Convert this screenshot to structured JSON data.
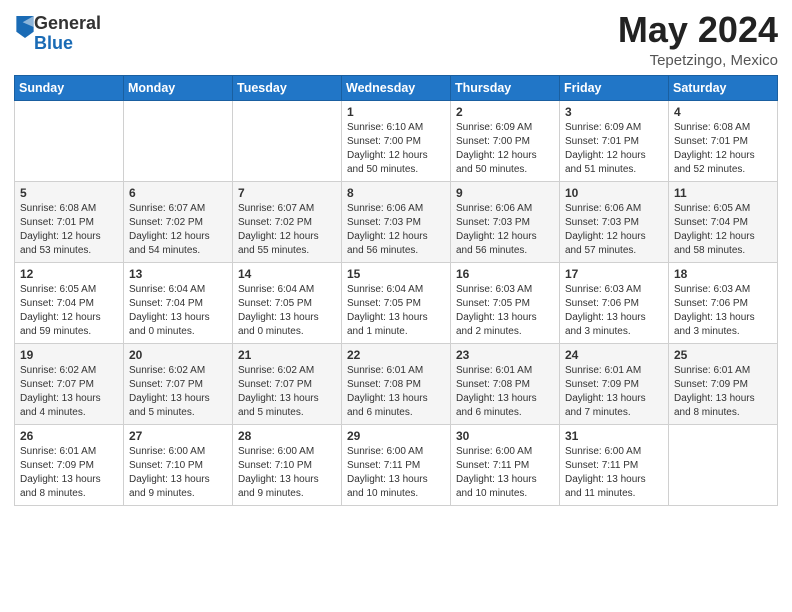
{
  "logo": {
    "general": "General",
    "blue": "Blue"
  },
  "title": "May 2024",
  "subtitle": "Tepetzingo, Mexico",
  "days_of_week": [
    "Sunday",
    "Monday",
    "Tuesday",
    "Wednesday",
    "Thursday",
    "Friday",
    "Saturday"
  ],
  "weeks": [
    [
      {
        "day": "",
        "info": ""
      },
      {
        "day": "",
        "info": ""
      },
      {
        "day": "",
        "info": ""
      },
      {
        "day": "1",
        "info": "Sunrise: 6:10 AM\nSunset: 7:00 PM\nDaylight: 12 hours\nand 50 minutes."
      },
      {
        "day": "2",
        "info": "Sunrise: 6:09 AM\nSunset: 7:00 PM\nDaylight: 12 hours\nand 50 minutes."
      },
      {
        "day": "3",
        "info": "Sunrise: 6:09 AM\nSunset: 7:01 PM\nDaylight: 12 hours\nand 51 minutes."
      },
      {
        "day": "4",
        "info": "Sunrise: 6:08 AM\nSunset: 7:01 PM\nDaylight: 12 hours\nand 52 minutes."
      }
    ],
    [
      {
        "day": "5",
        "info": "Sunrise: 6:08 AM\nSunset: 7:01 PM\nDaylight: 12 hours\nand 53 minutes."
      },
      {
        "day": "6",
        "info": "Sunrise: 6:07 AM\nSunset: 7:02 PM\nDaylight: 12 hours\nand 54 minutes."
      },
      {
        "day": "7",
        "info": "Sunrise: 6:07 AM\nSunset: 7:02 PM\nDaylight: 12 hours\nand 55 minutes."
      },
      {
        "day": "8",
        "info": "Sunrise: 6:06 AM\nSunset: 7:03 PM\nDaylight: 12 hours\nand 56 minutes."
      },
      {
        "day": "9",
        "info": "Sunrise: 6:06 AM\nSunset: 7:03 PM\nDaylight: 12 hours\nand 56 minutes."
      },
      {
        "day": "10",
        "info": "Sunrise: 6:06 AM\nSunset: 7:03 PM\nDaylight: 12 hours\nand 57 minutes."
      },
      {
        "day": "11",
        "info": "Sunrise: 6:05 AM\nSunset: 7:04 PM\nDaylight: 12 hours\nand 58 minutes."
      }
    ],
    [
      {
        "day": "12",
        "info": "Sunrise: 6:05 AM\nSunset: 7:04 PM\nDaylight: 12 hours\nand 59 minutes."
      },
      {
        "day": "13",
        "info": "Sunrise: 6:04 AM\nSunset: 7:04 PM\nDaylight: 13 hours\nand 0 minutes."
      },
      {
        "day": "14",
        "info": "Sunrise: 6:04 AM\nSunset: 7:05 PM\nDaylight: 13 hours\nand 0 minutes."
      },
      {
        "day": "15",
        "info": "Sunrise: 6:04 AM\nSunset: 7:05 PM\nDaylight: 13 hours\nand 1 minute."
      },
      {
        "day": "16",
        "info": "Sunrise: 6:03 AM\nSunset: 7:05 PM\nDaylight: 13 hours\nand 2 minutes."
      },
      {
        "day": "17",
        "info": "Sunrise: 6:03 AM\nSunset: 7:06 PM\nDaylight: 13 hours\nand 3 minutes."
      },
      {
        "day": "18",
        "info": "Sunrise: 6:03 AM\nSunset: 7:06 PM\nDaylight: 13 hours\nand 3 minutes."
      }
    ],
    [
      {
        "day": "19",
        "info": "Sunrise: 6:02 AM\nSunset: 7:07 PM\nDaylight: 13 hours\nand 4 minutes."
      },
      {
        "day": "20",
        "info": "Sunrise: 6:02 AM\nSunset: 7:07 PM\nDaylight: 13 hours\nand 5 minutes."
      },
      {
        "day": "21",
        "info": "Sunrise: 6:02 AM\nSunset: 7:07 PM\nDaylight: 13 hours\nand 5 minutes."
      },
      {
        "day": "22",
        "info": "Sunrise: 6:01 AM\nSunset: 7:08 PM\nDaylight: 13 hours\nand 6 minutes."
      },
      {
        "day": "23",
        "info": "Sunrise: 6:01 AM\nSunset: 7:08 PM\nDaylight: 13 hours\nand 6 minutes."
      },
      {
        "day": "24",
        "info": "Sunrise: 6:01 AM\nSunset: 7:09 PM\nDaylight: 13 hours\nand 7 minutes."
      },
      {
        "day": "25",
        "info": "Sunrise: 6:01 AM\nSunset: 7:09 PM\nDaylight: 13 hours\nand 8 minutes."
      }
    ],
    [
      {
        "day": "26",
        "info": "Sunrise: 6:01 AM\nSunset: 7:09 PM\nDaylight: 13 hours\nand 8 minutes."
      },
      {
        "day": "27",
        "info": "Sunrise: 6:00 AM\nSunset: 7:10 PM\nDaylight: 13 hours\nand 9 minutes."
      },
      {
        "day": "28",
        "info": "Sunrise: 6:00 AM\nSunset: 7:10 PM\nDaylight: 13 hours\nand 9 minutes."
      },
      {
        "day": "29",
        "info": "Sunrise: 6:00 AM\nSunset: 7:11 PM\nDaylight: 13 hours\nand 10 minutes."
      },
      {
        "day": "30",
        "info": "Sunrise: 6:00 AM\nSunset: 7:11 PM\nDaylight: 13 hours\nand 10 minutes."
      },
      {
        "day": "31",
        "info": "Sunrise: 6:00 AM\nSunset: 7:11 PM\nDaylight: 13 hours\nand 11 minutes."
      },
      {
        "day": "",
        "info": ""
      }
    ]
  ]
}
